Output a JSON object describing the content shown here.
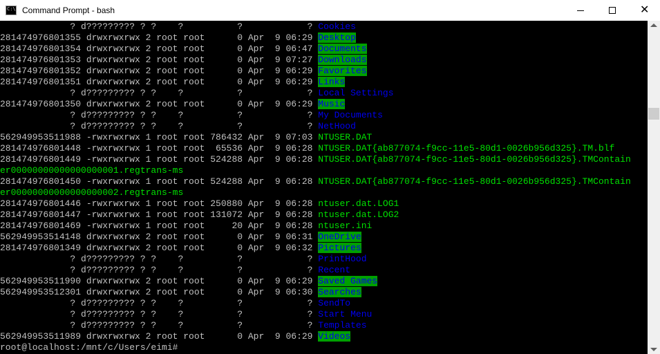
{
  "window": {
    "title": "Command Prompt - bash",
    "icon_text": "C:\\"
  },
  "colors": {
    "dir_fg": "#0000ee",
    "dir_bg": "#00a000",
    "file": "#00e000",
    "text": "#c0c0c0",
    "console_bg": "#000000"
  },
  "icons": {
    "app": "console-app-icon",
    "minimize": "minimize-icon",
    "maximize": "maximize-icon",
    "close": "close-icon"
  },
  "terminal": {
    "lines": [
      {
        "meta": "             ? d????????? ? ?    ?          ?            ? ",
        "name": "Cookies",
        "kind": "unk"
      },
      {
        "meta": "281474976801355 drwxrwxrwx 2 root root      0 Apr  9 06:29 ",
        "name": "Desktop",
        "kind": "dir"
      },
      {
        "meta": "281474976801354 drwxrwxrwx 2 root root      0 Apr  9 06:47 ",
        "name": "Documents",
        "kind": "dir"
      },
      {
        "meta": "281474976801353 drwxrwxrwx 2 root root      0 Apr  9 07:27 ",
        "name": "Downloads",
        "kind": "dir"
      },
      {
        "meta": "281474976801352 drwxrwxrwx 2 root root      0 Apr  9 06:29 ",
        "name": "Favorites",
        "kind": "dir"
      },
      {
        "meta": "281474976801351 drwxrwxrwx 2 root root      0 Apr  9 06:29 ",
        "name": "Links",
        "kind": "dir"
      },
      {
        "meta": "             ? d????????? ? ?    ?          ?            ? ",
        "name": "Local Settings",
        "kind": "unk"
      },
      {
        "meta": "281474976801350 drwxrwxrwx 2 root root      0 Apr  9 06:29 ",
        "name": "Music",
        "kind": "dir"
      },
      {
        "meta": "             ? d????????? ? ?    ?          ?            ? ",
        "name": "My Documents",
        "kind": "unk"
      },
      {
        "meta": "             ? d????????? ? ?    ?          ?            ? ",
        "name": "NetHood",
        "kind": "unk"
      },
      {
        "meta": "562949953511988 -rwxrwxrwx 1 root root 786432 Apr  9 07:03 ",
        "name": "NTUSER.DAT",
        "kind": "file"
      },
      {
        "meta": "281474976801448 -rwxrwxrwx 1 root root  65536 Apr  9 06:28 ",
        "name": "NTUSER.DAT{ab877074-f9cc-11e5-80d1-0026b956d325}.TM.blf",
        "kind": "file"
      },
      {
        "meta": "281474976801449 -rwxrwxrwx 1 root root 524288 Apr  9 06:28 ",
        "name": "NTUSER.DAT{ab877074-f9cc-11e5-80d1-0026b956d325}.TMContain",
        "kind": "file"
      },
      {
        "meta": "",
        "name": "er00000000000000000001.regtrans-ms",
        "kind": "file"
      },
      {
        "meta": "281474976801450 -rwxrwxrwx 1 root root 524288 Apr  9 06:28 ",
        "name": "NTUSER.DAT{ab877074-f9cc-11e5-80d1-0026b956d325}.TMContain",
        "kind": "file"
      },
      {
        "meta": "",
        "name": "er00000000000000000002.regtrans-ms",
        "kind": "file"
      },
      {
        "meta": "281474976801446 -rwxrwxrwx 1 root root 250880 Apr  9 06:28 ",
        "name": "ntuser.dat.LOG1",
        "kind": "file"
      },
      {
        "meta": "281474976801447 -rwxrwxrwx 1 root root 131072 Apr  9 06:28 ",
        "name": "ntuser.dat.LOG2",
        "kind": "file"
      },
      {
        "meta": "281474976801469 -rwxrwxrwx 1 root root     20 Apr  9 06:28 ",
        "name": "ntuser.ini",
        "kind": "file"
      },
      {
        "meta": "562949953514148 drwxrwxrwx 2 root root      0 Apr  9 06:31 ",
        "name": "OneDrive",
        "kind": "dir"
      },
      {
        "meta": "281474976801349 drwxrwxrwx 2 root root      0 Apr  9 06:32 ",
        "name": "Pictures",
        "kind": "dir"
      },
      {
        "meta": "             ? d????????? ? ?    ?          ?            ? ",
        "name": "PrintHood",
        "kind": "unk"
      },
      {
        "meta": "             ? d????????? ? ?    ?          ?            ? ",
        "name": "Recent",
        "kind": "unk"
      },
      {
        "meta": "562949953511990 drwxrwxrwx 2 root root      0 Apr  9 06:29 ",
        "name": "Saved Games",
        "kind": "dir"
      },
      {
        "meta": "562949953512301 drwxrwxrwx 2 root root      0 Apr  9 06:30 ",
        "name": "Searches",
        "kind": "dir"
      },
      {
        "meta": "             ? d????????? ? ?    ?          ?            ? ",
        "name": "SendTo",
        "kind": "unk"
      },
      {
        "meta": "             ? d????????? ? ?    ?          ?            ? ",
        "name": "Start Menu",
        "kind": "unk"
      },
      {
        "meta": "             ? d????????? ? ?    ?          ?            ? ",
        "name": "Templates",
        "kind": "unk"
      },
      {
        "meta": "562949953511989 drwxrwxrwx 2 root root      0 Apr  9 06:29 ",
        "name": "Videos",
        "kind": "dir"
      }
    ],
    "prompt": "root@localhost:/mnt/c/Users/eimi#"
  }
}
